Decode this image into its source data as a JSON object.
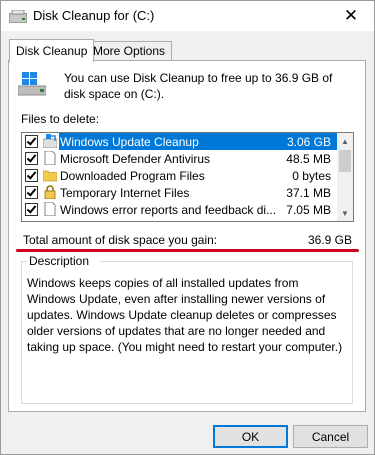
{
  "window": {
    "title": "Disk Cleanup for  (C:)",
    "close_glyph": "✕"
  },
  "tabs": [
    {
      "label": "Disk Cleanup",
      "active": true
    },
    {
      "label": "More Options",
      "active": false
    }
  ],
  "intro_text": "You can use Disk Cleanup to free up to 36.9 GB of disk space on  (C:).",
  "files_label": "Files to delete:",
  "files": [
    {
      "name": "Windows Update Cleanup",
      "size": "3.06 GB",
      "checked": true,
      "selected": true,
      "icon": "windows-update-icon"
    },
    {
      "name": "Microsoft Defender Antivirus",
      "size": "48.5 MB",
      "checked": true,
      "selected": false,
      "icon": "file-icon"
    },
    {
      "name": "Downloaded Program Files",
      "size": "0 bytes",
      "checked": true,
      "selected": false,
      "icon": "folder-icon"
    },
    {
      "name": "Temporary Internet Files",
      "size": "37.1 MB",
      "checked": true,
      "selected": false,
      "icon": "lock-icon"
    },
    {
      "name": "Windows error reports and feedback di...",
      "size": "7.05 MB",
      "checked": true,
      "selected": false,
      "icon": "file-icon"
    }
  ],
  "total": {
    "label": "Total amount of disk space you gain:",
    "value": "36.9 GB"
  },
  "description": {
    "legend": "Description",
    "text": "Windows keeps copies of all installed updates from Windows Update, even after installing newer versions of updates. Windows Update cleanup deletes or compresses older versions of updates that are no longer needed and taking up space. (You might need to restart your computer.)"
  },
  "buttons": {
    "ok": "OK",
    "cancel": "Cancel"
  },
  "colors": {
    "selection": "#0078d7",
    "annotation_underline": "#d0021b"
  }
}
